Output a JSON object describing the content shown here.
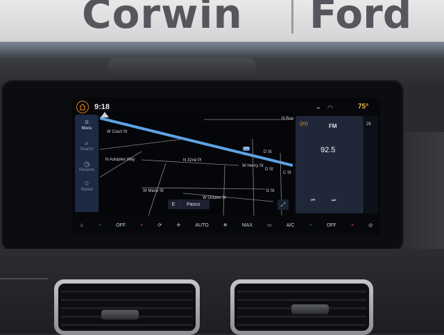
{
  "sign": {
    "left": "Corwin",
    "right": "Ford"
  },
  "status": {
    "time": "9:18",
    "temperature": "75°"
  },
  "sidebar": {
    "items": [
      {
        "label": "Menu",
        "icon": "menu-icon"
      },
      {
        "label": "Search",
        "icon": "search-icon"
      },
      {
        "label": "Recents",
        "icon": "clock-icon"
      },
      {
        "label": "Saved",
        "icon": "star-icon"
      }
    ]
  },
  "map": {
    "streets": {
      "court": "W Court St",
      "autoplex": "N Autoplex Way",
      "n32": "N 32nd Pl",
      "henry": "W Henry St",
      "marie": "W Marie St",
      "octave": "W Octave St",
      "nroad": "N Roa",
      "dst1": "D St",
      "dst2": "D St",
      "dst3": "D St",
      "cst": "C St"
    },
    "highway_badge": "395",
    "destination": {
      "direction": "E",
      "name": "Pasco"
    }
  },
  "radio": {
    "band": "FM",
    "frequency": "92.5",
    "right_label": "28"
  },
  "climate": {
    "left_off": "OFF",
    "auto": "AUTO",
    "max": "MAX",
    "ac": "A/C",
    "right_off": "OFF"
  },
  "colors": {
    "accent": "#d57a26",
    "temp": "#f0b640",
    "route": "#5ea3e6",
    "panel": "#1f2738"
  }
}
